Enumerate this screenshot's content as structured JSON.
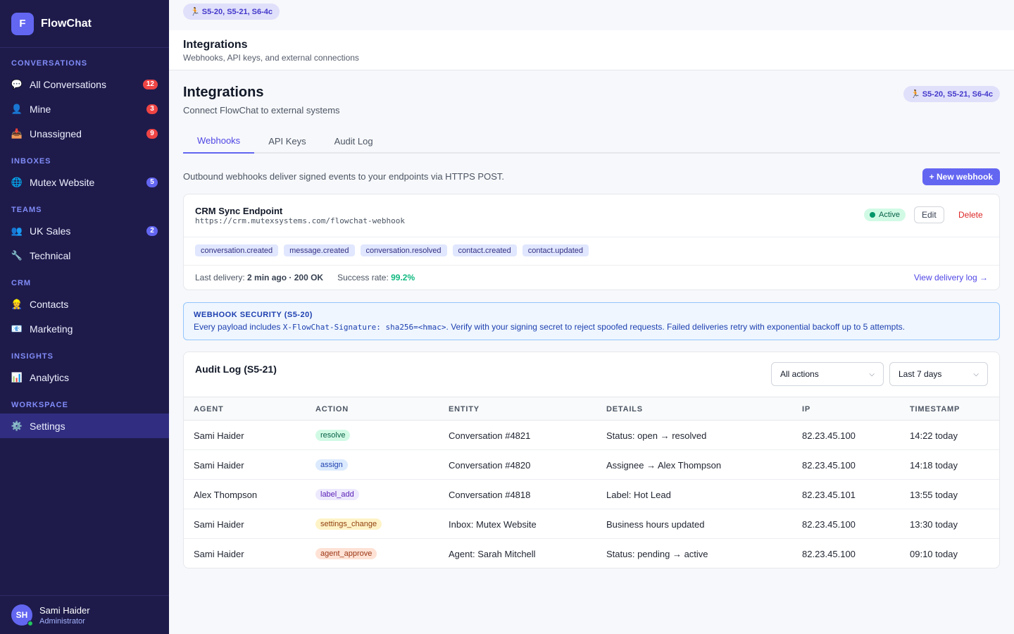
{
  "brand": {
    "logo_letter": "F",
    "name": "FlowChat"
  },
  "sidebar": {
    "sections": [
      {
        "title": "CONVERSATIONS",
        "items": [
          {
            "icon": "💬",
            "label": "All Conversations",
            "badge": "12",
            "badge_color": "#ef4444"
          },
          {
            "icon": "👤",
            "label": "Mine",
            "badge": "3",
            "badge_color": "#ef4444"
          },
          {
            "icon": "📥",
            "label": "Unassigned",
            "badge": "9",
            "badge_color": "#ef4444"
          }
        ]
      },
      {
        "title": "INBOXES",
        "items": [
          {
            "icon": "🌐",
            "label": "Mutex Website",
            "badge": "5",
            "badge_color": "#6366f1"
          }
        ]
      },
      {
        "title": "TEAMS",
        "items": [
          {
            "icon": "👥",
            "label": "UK Sales",
            "badge": "2",
            "badge_color": "#6366f1"
          },
          {
            "icon": "🔧",
            "label": "Technical",
            "badge": ""
          }
        ]
      },
      {
        "title": "CRM",
        "items": [
          {
            "icon": "👷",
            "label": "Contacts",
            "badge": ""
          },
          {
            "icon": "📧",
            "label": "Marketing",
            "badge": ""
          }
        ]
      },
      {
        "title": "INSIGHTS",
        "items": [
          {
            "icon": "📊",
            "label": "Analytics",
            "badge": ""
          }
        ]
      },
      {
        "title": "WORKSPACE",
        "items": [
          {
            "icon": "⚙️",
            "label": "Settings",
            "badge": "",
            "active": true
          }
        ]
      }
    ]
  },
  "user": {
    "initials": "SH",
    "name": "Sami Haider",
    "role": "Administrator"
  },
  "top_pill": "🏃 S5-20, S5-21, S6-4c",
  "page_header": {
    "title": "Integrations",
    "subtitle": "Webhooks, API keys, and external connections"
  },
  "section": {
    "title": "Integrations",
    "subtitle": "Connect FlowChat to external systems",
    "pill": "🏃 S5-20, S5-21, S6-4c"
  },
  "tabs": [
    "Webhooks",
    "API Keys",
    "Audit Log"
  ],
  "active_tab": 0,
  "webhooks": {
    "intro": "Outbound webhooks deliver signed events to your endpoints via HTTPS POST.",
    "new_button": "+ New webhook",
    "item": {
      "name": "CRM Sync Endpoint",
      "url": "https://crm.mutexsystems.com/flowchat-webhook",
      "status": "Active",
      "edit_label": "Edit",
      "delete_label": "Delete",
      "events": [
        "conversation.created",
        "message.created",
        "conversation.resolved",
        "contact.created",
        "contact.updated"
      ],
      "last_delivery_label": "Last delivery:",
      "last_delivery_value": "2 min ago · 200 OK",
      "success_label": "Success rate:",
      "success_value": "99.2%",
      "view_log": "View delivery log →"
    }
  },
  "security": {
    "title": "WEBHOOK SECURITY (S5-20)",
    "text_before": "Every payload includes ",
    "code": "X-FlowChat-Signature: sha256=<hmac>",
    "text_after": ". Verify with your signing secret to reject spoofed requests. Failed deliveries retry with exponential backoff up to 5 attempts."
  },
  "audit": {
    "title": "Audit Log (S5-21)",
    "filter_action": "All actions",
    "filter_range": "Last 7 days",
    "columns": [
      "AGENT",
      "ACTION",
      "ENTITY",
      "DETAILS",
      "IP",
      "TIMESTAMP"
    ],
    "rows": [
      {
        "agent": "Sami Haider",
        "action": "resolve",
        "entity": "Conversation #4821",
        "details": "Status: open → resolved",
        "ip": "82.23.45.100",
        "ts": "14:22 today"
      },
      {
        "agent": "Sami Haider",
        "action": "assign",
        "entity": "Conversation #4820",
        "details": "Assignee → Alex Thompson",
        "ip": "82.23.45.100",
        "ts": "14:18 today"
      },
      {
        "agent": "Alex Thompson",
        "action": "label_add",
        "entity": "Conversation #4818",
        "details": "Label: Hot Lead",
        "ip": "82.23.45.101",
        "ts": "13:55 today"
      },
      {
        "agent": "Sami Haider",
        "action": "settings_change",
        "entity": "Inbox: Mutex Website",
        "details": "Business hours updated",
        "ip": "82.23.45.100",
        "ts": "13:30 today"
      },
      {
        "agent": "Sami Haider",
        "action": "agent_approve",
        "entity": "Agent: Sarah Mitchell",
        "details": "Status: pending → active",
        "ip": "82.23.45.100",
        "ts": "09:10 today"
      }
    ]
  }
}
